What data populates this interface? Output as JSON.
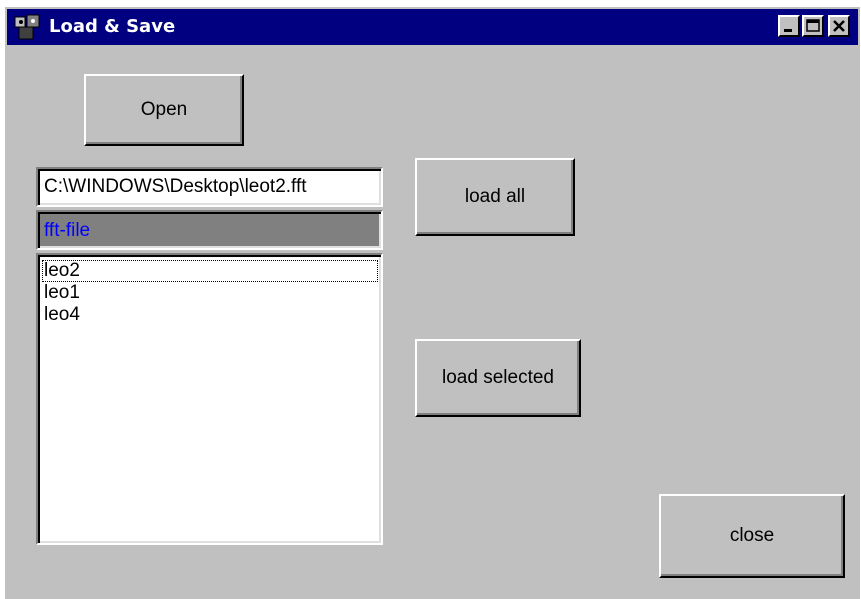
{
  "window": {
    "title": "Load & Save",
    "controls": {
      "minimize": "minimize-icon",
      "maximize": "maximize-icon",
      "close": "close-icon"
    }
  },
  "buttons": {
    "open": "Open",
    "load_all": "load all",
    "load_selected": "load selected",
    "close": "close"
  },
  "path_field": {
    "value": "C:\\WINDOWS\\Desktop\\leot2.fft"
  },
  "file_type": {
    "value": "fft-file"
  },
  "file_list": {
    "items": [
      {
        "label": "leo2",
        "focused": true
      },
      {
        "label": "leo1",
        "focused": false
      },
      {
        "label": "leo4",
        "focused": false
      }
    ]
  },
  "colors": {
    "titlebar": "#000080",
    "face": "#c0c0c0",
    "file_type_text": "#0000ff"
  }
}
